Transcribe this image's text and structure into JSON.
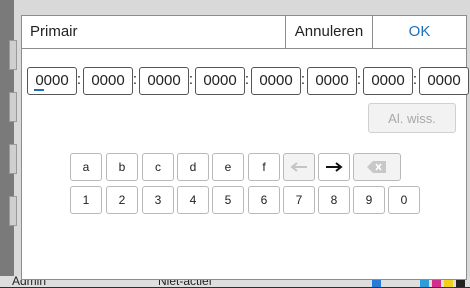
{
  "dialog": {
    "title": "Primair",
    "cancel_label": "Annuleren",
    "ok_label": "OK"
  },
  "address": {
    "fields": [
      "0000",
      "0000",
      "0000",
      "0000",
      "0000",
      "0000",
      "0000",
      "0000"
    ],
    "separator": ":"
  },
  "clear_label": "Al. wiss.",
  "keypad": {
    "letters": [
      "a",
      "b",
      "c",
      "d",
      "e",
      "f"
    ],
    "digits": [
      "1",
      "2",
      "3",
      "4",
      "5",
      "6",
      "7",
      "8",
      "9",
      "0"
    ],
    "icons": {
      "left": "arrow-left-icon",
      "right": "arrow-right-icon",
      "backspace": "backspace-icon"
    }
  },
  "background": {
    "user_label": "Admin",
    "status_label": "Niet-actief"
  },
  "colors": {
    "accent": "#1f6fb8",
    "disabled_text": "#a8a8a8"
  }
}
